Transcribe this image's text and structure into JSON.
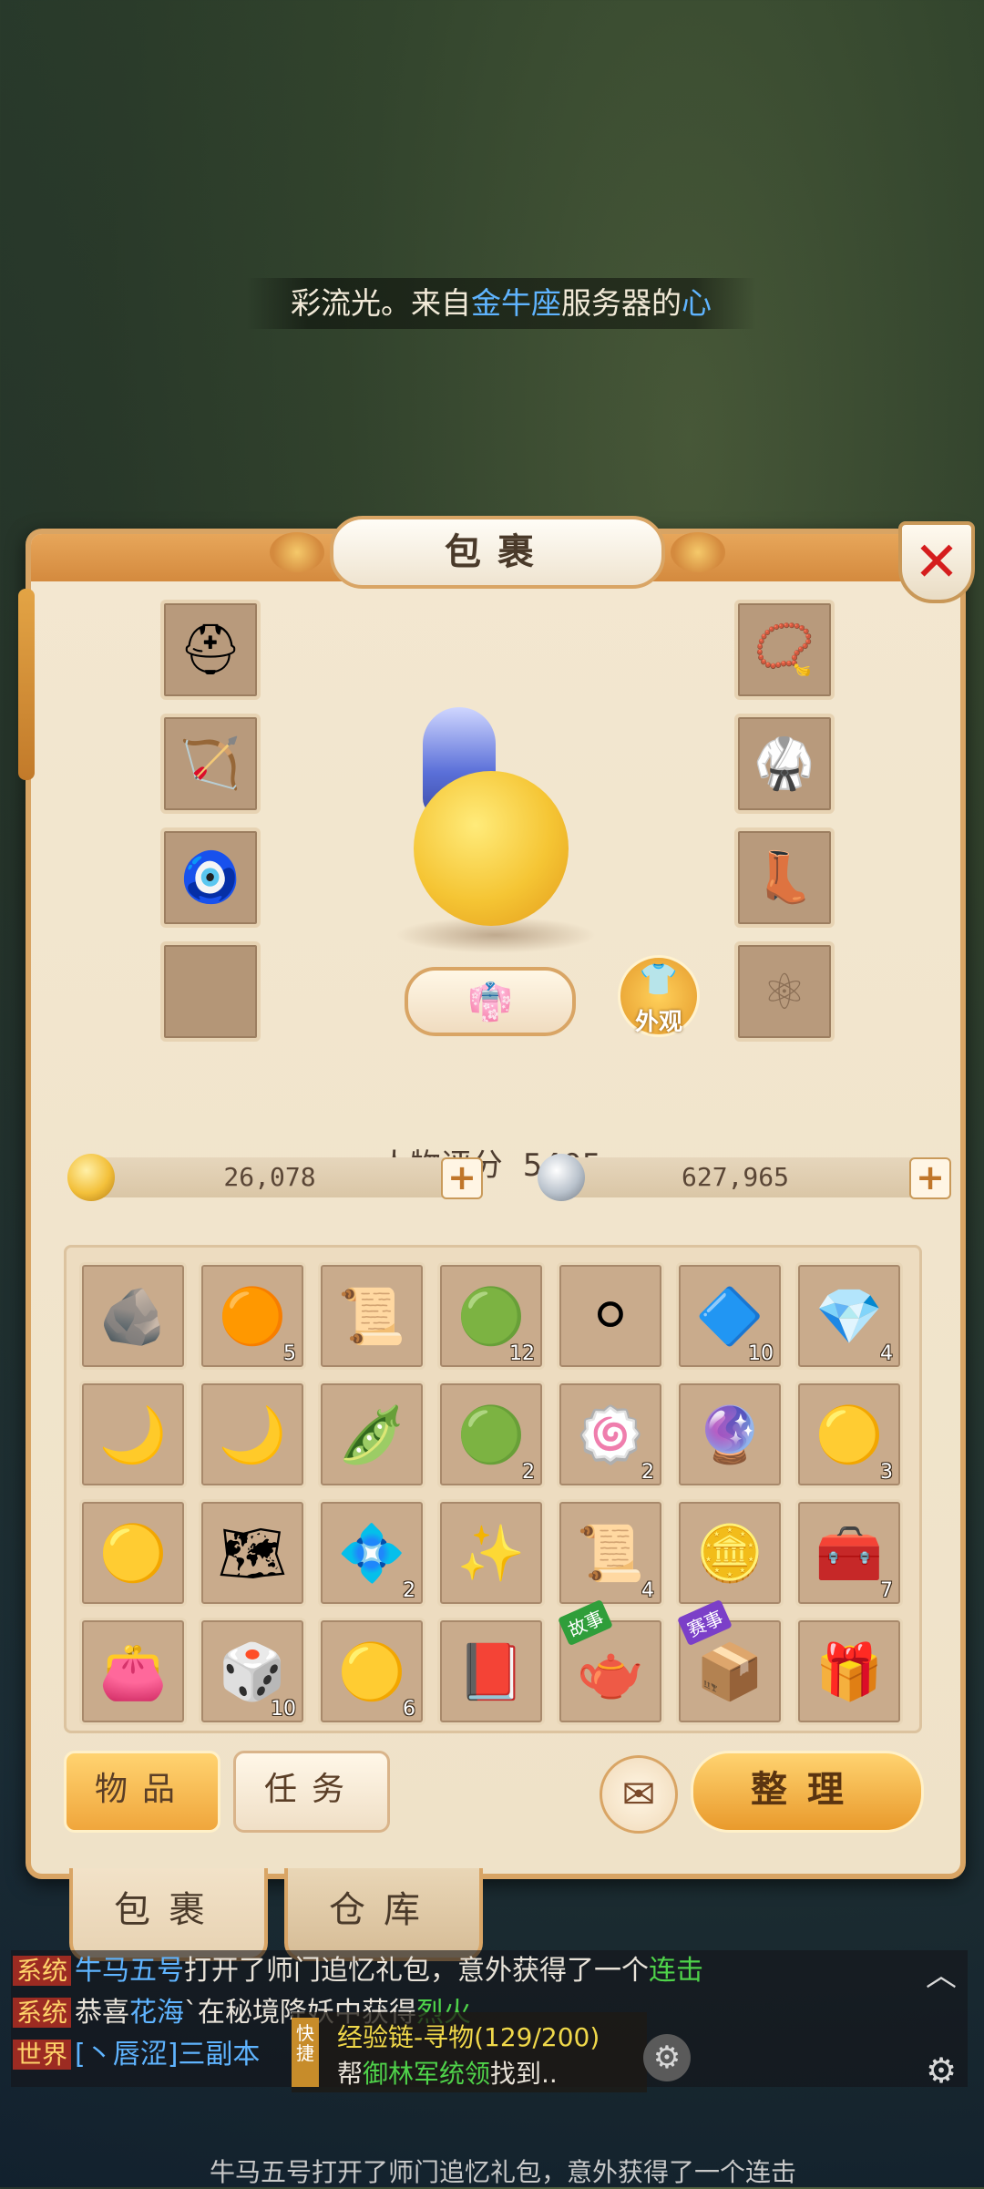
{
  "marquee": {
    "parts": [
      "彩流光。来自",
      "金牛座",
      "服务器的",
      "心"
    ]
  },
  "panel": {
    "title": "包裹",
    "close_glyph": "✕"
  },
  "character": {
    "score_label": "人物评分",
    "score_value": "5405",
    "appearance_label": "外观"
  },
  "equipment": {
    "left": [
      {
        "icon": "helmet-icon",
        "glyph": "⛑"
      },
      {
        "icon": "bow-icon",
        "glyph": "🏹"
      },
      {
        "icon": "charm-icon",
        "glyph": "🧿"
      },
      {
        "icon": "empty-slot",
        "glyph": ""
      }
    ],
    "right": [
      {
        "icon": "pendant-icon",
        "glyph": "📿"
      },
      {
        "icon": "armor-icon",
        "glyph": "🥋"
      },
      {
        "icon": "boots-icon",
        "glyph": "👢"
      },
      {
        "icon": "locked-slot-icon",
        "glyph": "⚛"
      }
    ]
  },
  "currency": {
    "gold": {
      "value": "26,078",
      "icon": "gold-coin-icon",
      "color": "#f3c03a"
    },
    "silver": {
      "value": "627,965",
      "icon": "silver-coin-icon",
      "color": "#b9c2cc"
    },
    "plus_glyph": "+"
  },
  "inventory": [
    {
      "icon": "ore-icon",
      "glyph": "🪨",
      "count": ""
    },
    {
      "icon": "pearl-icon",
      "glyph": "🟠",
      "count": "5"
    },
    {
      "icon": "scroll-icon",
      "glyph": "📜",
      "count": ""
    },
    {
      "icon": "jade-disc-icon",
      "glyph": "🟢",
      "count": "12"
    },
    {
      "icon": "tiger-token-icon",
      "glyph": "⚪",
      "count": ""
    },
    {
      "icon": "turtle-shell-icon",
      "glyph": "🔷",
      "count": "10"
    },
    {
      "icon": "crystal-icon",
      "glyph": "💎",
      "count": "4"
    },
    {
      "icon": "moon-crescent-icon",
      "glyph": "🌙",
      "count": ""
    },
    {
      "icon": "moon-crescent-icon",
      "glyph": "🌙",
      "count": ""
    },
    {
      "icon": "beans-icon",
      "glyph": "🫛",
      "count": ""
    },
    {
      "icon": "green-orb-icon",
      "glyph": "🟢",
      "count": "2"
    },
    {
      "icon": "swirl-candy-icon",
      "glyph": "🍥",
      "count": "2"
    },
    {
      "icon": "amethyst-icon",
      "glyph": "🔮",
      "count": ""
    },
    {
      "icon": "gold-ingot-icon",
      "glyph": "🟡",
      "count": "3"
    },
    {
      "icon": "gold-ingot-icon",
      "glyph": "🟡",
      "count": ""
    },
    {
      "icon": "map-scroll-icon",
      "glyph": "🗺",
      "count": ""
    },
    {
      "icon": "jade-shards-icon",
      "glyph": "💠",
      "count": "2"
    },
    {
      "icon": "spirit-flame-icon",
      "glyph": "✨",
      "count": ""
    },
    {
      "icon": "red-scroll-icon",
      "glyph": "📜",
      "count": "4"
    },
    {
      "icon": "gold-coins-icon",
      "glyph": "🪙",
      "count": ""
    },
    {
      "icon": "treasure-chest-icon",
      "glyph": "🧰",
      "count": "7"
    },
    {
      "icon": "purple-pouch-icon",
      "glyph": "👛",
      "count": ""
    },
    {
      "icon": "green-box-icon",
      "glyph": "🎲",
      "count": "10"
    },
    {
      "icon": "golden-orb-icon",
      "glyph": "🟡",
      "count": "6"
    },
    {
      "icon": "book-icon",
      "glyph": "📕",
      "count": ""
    },
    {
      "icon": "teapot-icon",
      "glyph": "🫖",
      "count": "",
      "tag": "故事",
      "tag_color": "#2f9e3a"
    },
    {
      "icon": "scroll-box-icon",
      "glyph": "📦",
      "count": "",
      "tag": "赛事",
      "tag_color": "#7b3fc8"
    },
    {
      "icon": "red-gift-icon",
      "glyph": "🎁",
      "count": ""
    }
  ],
  "buttons": {
    "items_tab": "物品",
    "tasks_tab": "任务",
    "mail_glyph": "✉",
    "sort": "整理"
  },
  "bottom_tabs": {
    "bag": "包裹",
    "warehouse": "仓库"
  },
  "chat": {
    "rows": [
      {
        "tag": "系统",
        "a": "牛马五号",
        "b": "打开了师门追忆礼包，意外获得了一个",
        "c": "连击"
      },
      {
        "tag": "系统",
        "a": "恭喜",
        "b": "花海",
        "c": "`在秘境降妖中获得",
        "d": "烈火"
      },
      {
        "tag": "世界",
        "a": "[丶唇涩]三副本"
      }
    ],
    "caret": "︿",
    "gear": "⚙"
  },
  "quest": {
    "tag": "快捷",
    "line1": "经验链-寻物(129/200)",
    "line2_prefix": "帮",
    "line2_npc": "御林军统领",
    "line2_suffix": "找到.."
  },
  "footer": {
    "text": "牛马五号打开了师门追忆礼包，意外获得了一个连击"
  }
}
